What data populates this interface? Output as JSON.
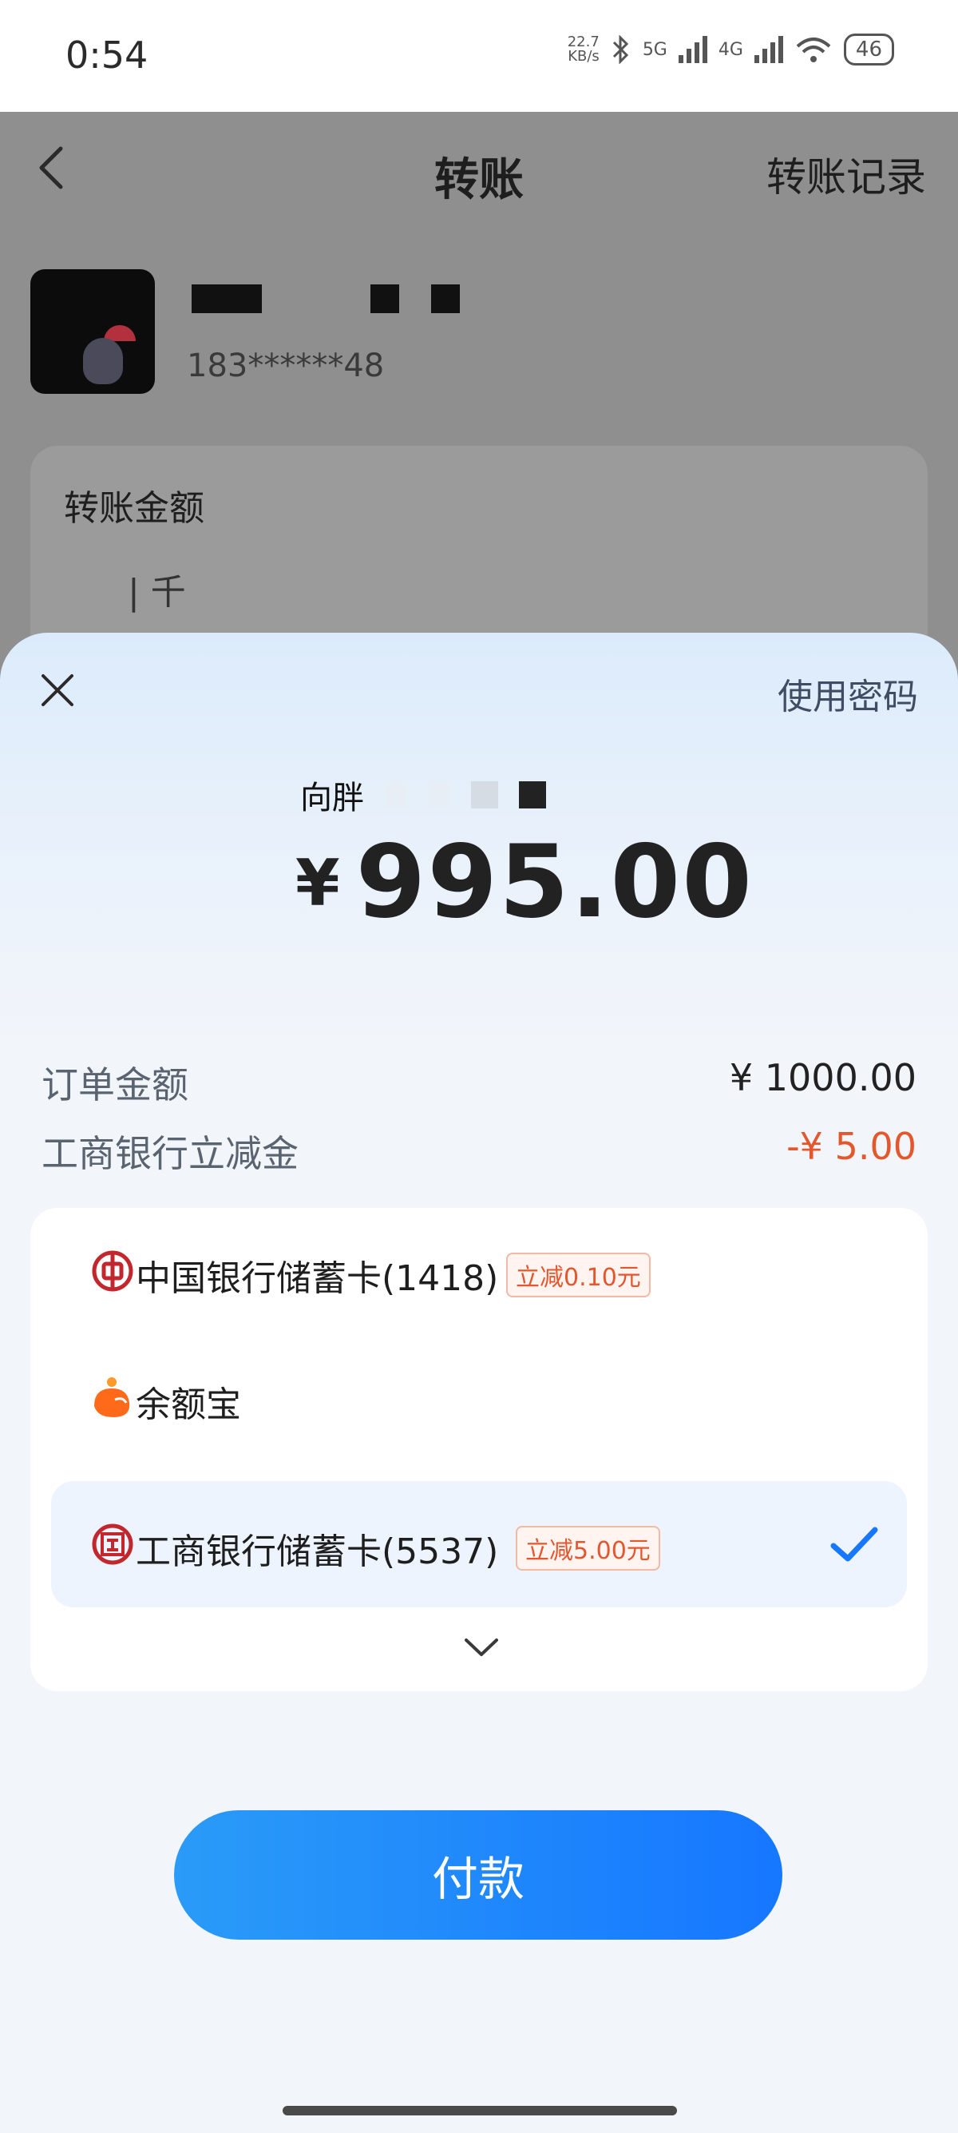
{
  "status_bar": {
    "time": "0:54",
    "speed": "22.7\nKB/s",
    "net1": "5G",
    "net2": "4G",
    "battery": "46"
  },
  "background": {
    "title": "转账",
    "history_link": "转账记录",
    "recipient_phone": "183******48",
    "amount_card_title": "转账金额",
    "amount_unit": "| 千"
  },
  "sheet": {
    "use_password": "使用密码",
    "payee_prefix": "向胖",
    "currency": "¥",
    "amount": "995.00",
    "order_amount_label": "订单金额",
    "order_amount_value": "¥ 1000.00",
    "discount_label": "工商银行立减金",
    "discount_value": "-¥ 5.00",
    "methods": [
      {
        "label": "中国银行储蓄卡(1418)",
        "promo": "立减0.10元",
        "icon": "boc-icon",
        "selected": false
      },
      {
        "label": "余额宝",
        "promo": "",
        "icon": "yuebao-icon",
        "selected": false
      },
      {
        "label": "工商银行储蓄卡(5537)",
        "promo": "立减5.00元",
        "icon": "icbc-icon",
        "selected": true
      }
    ],
    "pay_button": "付款"
  },
  "colors": {
    "accent": "#1677ff",
    "discount": "#e4572e",
    "bank_red": "#c1272d"
  }
}
